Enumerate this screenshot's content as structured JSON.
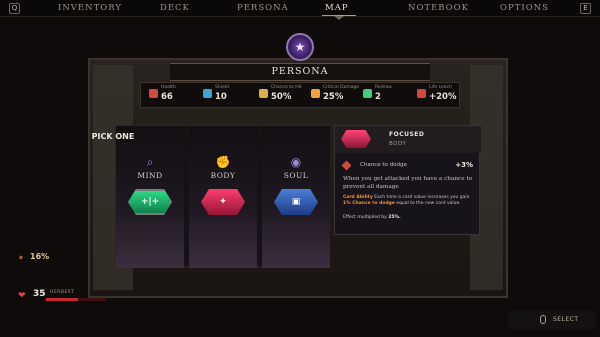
{
  "nav": {
    "left_key": "Q",
    "right_key": "E",
    "tabs": [
      "INVENTORY",
      "DECK",
      "PERSONA",
      "MAP",
      "NOTEBOOK",
      "OPTIONS"
    ],
    "active_tab": "MAP"
  },
  "panel_title": "PERSONA",
  "stats": [
    {
      "label": "Health",
      "value": "66",
      "icon": "heart-icon",
      "color": "#d4483d"
    },
    {
      "label": "Shield",
      "value": "10",
      "icon": "shield-icon",
      "color": "#3aa6c9"
    },
    {
      "label": "Chance to Hit",
      "value": "50%",
      "icon": "target-icon",
      "color": "#d7b24a"
    },
    {
      "label": "Critical Damage",
      "value": "25%",
      "icon": "burst-icon",
      "color": "#f0a43a"
    },
    {
      "label": "Redraw",
      "value": "2",
      "icon": "redraw-icon",
      "color": "#3fcf7f"
    },
    {
      "label": "Life Leech",
      "value": "+20%",
      "icon": "leech-icon",
      "color": "#d4483d"
    }
  ],
  "pick_one_label": "PICK ONE",
  "choices": [
    {
      "label": "MIND",
      "icon": "mind-icon",
      "gem_glyph": "+|+",
      "gem_color": "#1fbf73"
    },
    {
      "label": "BODY",
      "icon": "body-icon",
      "gem_glyph": "✦",
      "gem_color": "#e0284f"
    },
    {
      "label": "SOUL",
      "icon": "soul-icon",
      "gem_glyph": "▣",
      "gem_color": "#3b6ccb"
    }
  ],
  "detail": {
    "title": "FOCUSED",
    "subtitle": "BODY",
    "stat_label": "Chance to dodge",
    "stat_value": "+3%",
    "description": "When you get attacked you have a chance to prevent all damage",
    "ability_label": "Card Ability",
    "ability_text_1": "Each time a card value increases you gain",
    "ability_highlight": "1% Chance to dodge",
    "ability_text_2": "equal to the new card value.",
    "multiplier_text": "Effect multiplied by",
    "multiplier_value": "25%."
  },
  "hud": {
    "percent_value": "16%",
    "health_value": "35",
    "health_name": "HERBERT",
    "health_fraction": 0.53
  },
  "select_label": "SELECT"
}
